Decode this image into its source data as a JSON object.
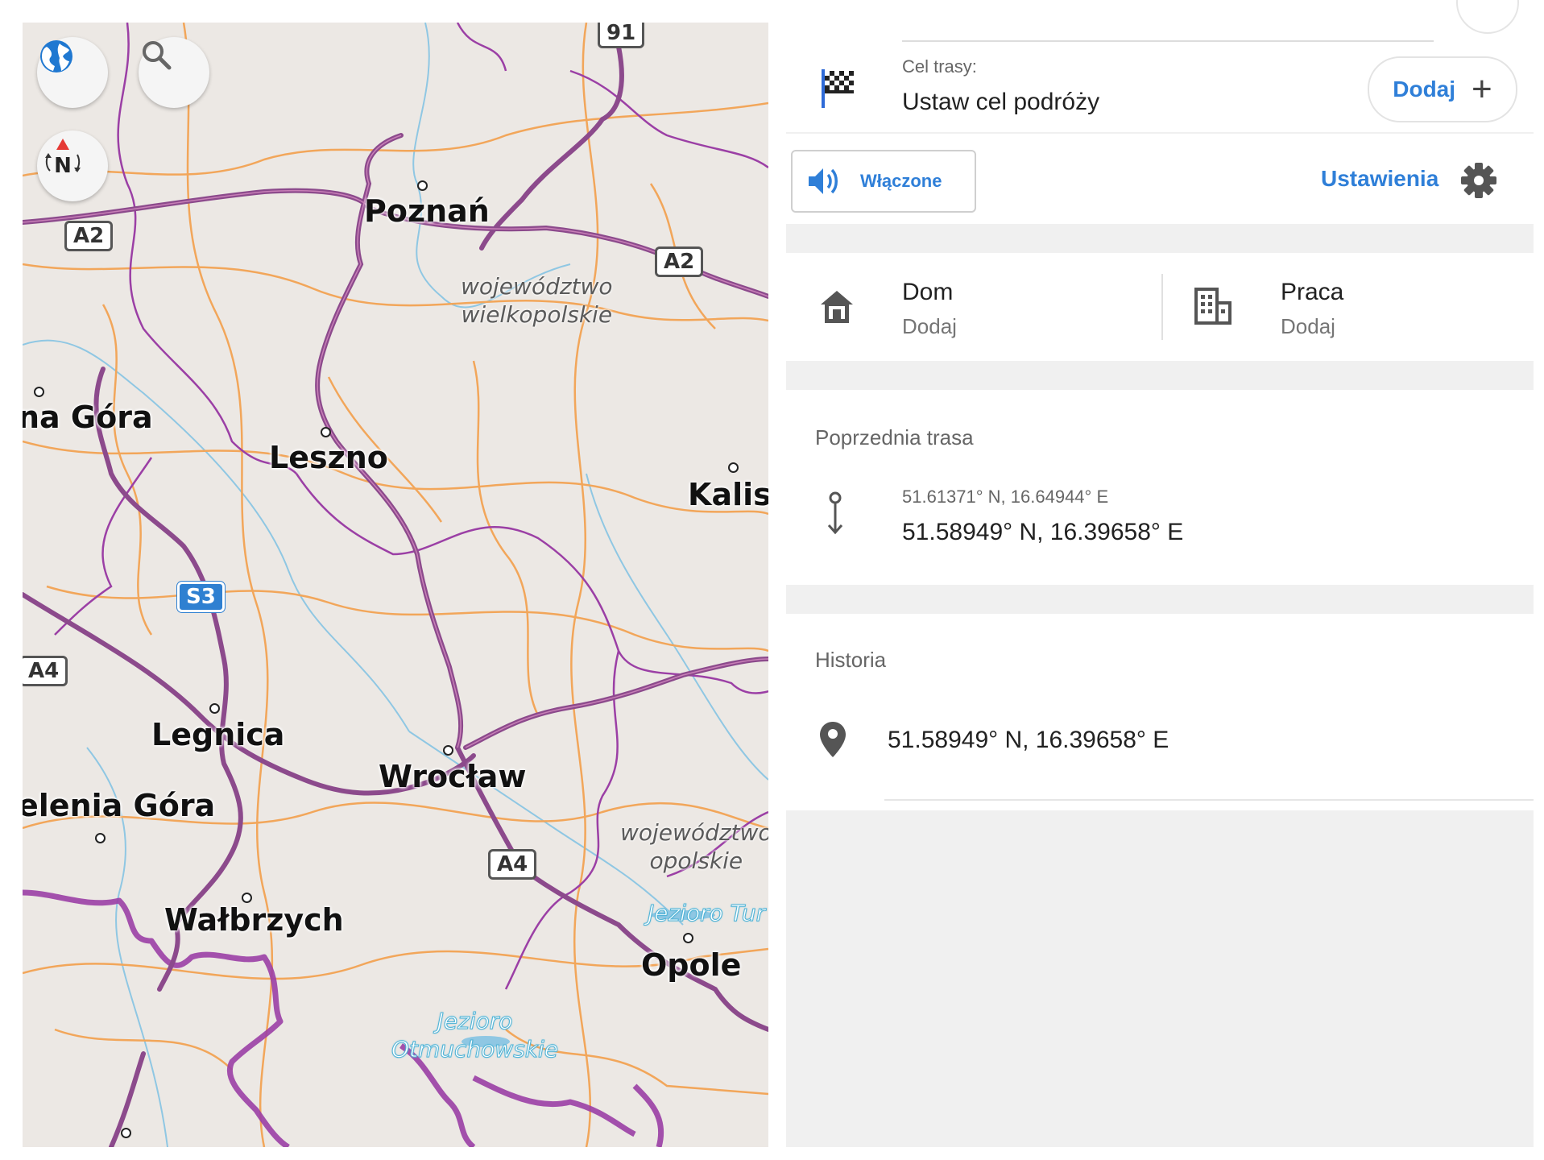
{
  "map": {
    "cities": [
      "Poznań",
      "na Góra",
      "Leszno",
      "Kalisz",
      "Legnica",
      "Wrocław",
      "elenia Góra",
      "Wałbrzych",
      "Opole"
    ],
    "regions": [
      [
        "województwo",
        "wielkopolskie"
      ],
      [
        "województwo",
        "opolskie"
      ]
    ],
    "lakes": [
      [
        "Jezioro",
        "Otmuchowskie"
      ],
      [
        "Jezioro Tur"
      ]
    ],
    "shields": [
      "91",
      "A2",
      "A2",
      "S3",
      "A4",
      "A4"
    ],
    "buttons": {
      "layers": "globe-icon",
      "search": "search-icon",
      "compass": "N"
    },
    "colors": {
      "land": "#ece8e4",
      "motorway": "#8c4a8c",
      "primary_road": "#f2a65a",
      "border": "#9b3fa5",
      "river": "#8fc7e3"
    }
  },
  "route": {
    "destination_label": "Cel trasy:",
    "destination_value": "Ustaw cel podróży",
    "add_label": "Dodaj"
  },
  "sound": {
    "toggle_label": "Włączone",
    "settings_label": "Ustawienia"
  },
  "shortcuts": {
    "home": {
      "title": "Dom",
      "subtitle": "Dodaj"
    },
    "work": {
      "title": "Praca",
      "subtitle": "Dodaj"
    }
  },
  "previous": {
    "header": "Poprzednia trasa",
    "from": "51.61371° N, 16.64944° E",
    "to": "51.58949° N, 16.39658° E"
  },
  "history": {
    "header": "Historia",
    "items": [
      "51.58949° N, 16.39658° E"
    ]
  },
  "accent_color": "#2f7fd8"
}
